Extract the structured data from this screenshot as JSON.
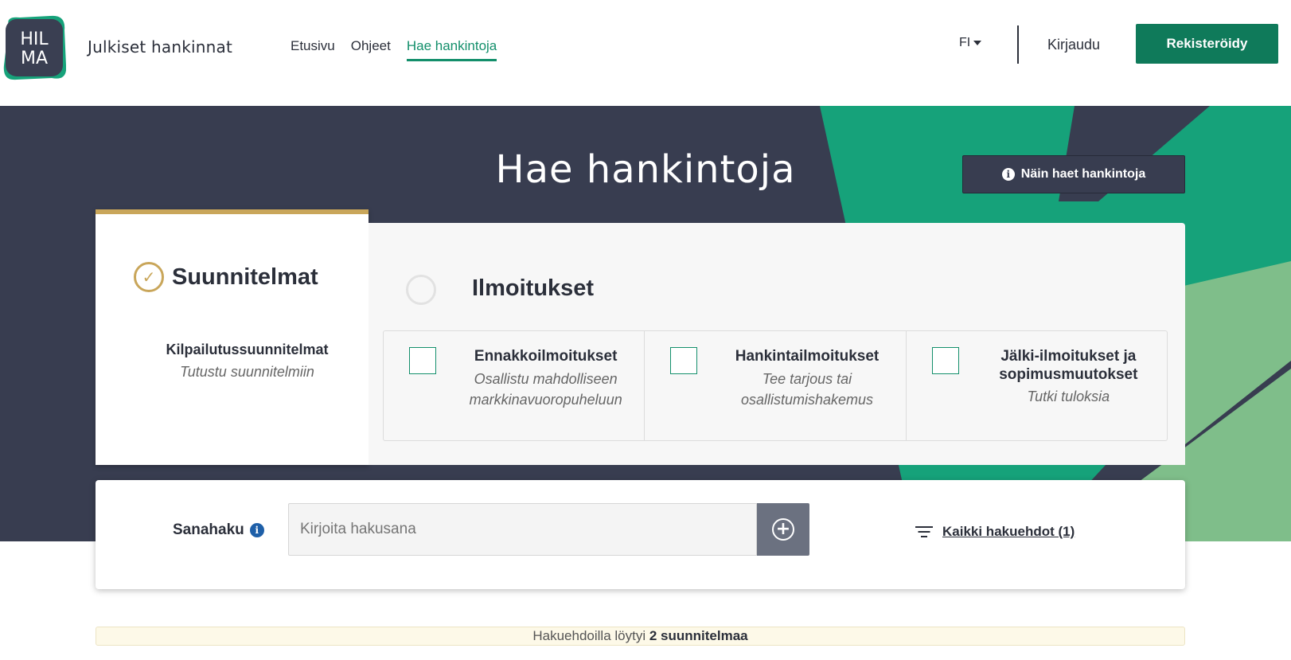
{
  "header": {
    "logo_text": "HIL MA",
    "brand": "Julkiset hankinnat",
    "nav": [
      {
        "label": "Etusivu",
        "active": false
      },
      {
        "label": "Ohjeet",
        "active": false
      },
      {
        "label": "Hae hankintoja",
        "active": true
      }
    ],
    "language": "FI",
    "login_label": "Kirjaudu",
    "register_label": "Rekisteröidy"
  },
  "hero": {
    "title": "Hae hankintoja",
    "help_button": "Näin haet hankintoja",
    "help_icon": "info-icon"
  },
  "tabs": {
    "plans": {
      "title": "Suunnitelmat",
      "selected": true,
      "subtitle": "Kilpailutussuunnitelmat",
      "description": "Tutustu suunnitelmiin"
    },
    "notices": {
      "title": "Ilmoitukset",
      "selected": false,
      "items": [
        {
          "title": "Ennakkoilmoitukset",
          "description_line1": "Osallistu mahdolliseen",
          "description_line2": "markkinavuoropuheluun",
          "checked": false
        },
        {
          "title": "Hankintailmoitukset",
          "description_line1": "Tee tarjous tai",
          "description_line2": "osallistumishakemus",
          "checked": false
        },
        {
          "title_line1": "Jälki-ilmoitukset ja",
          "title_line2": "sopimusmuutokset",
          "description": "Tutki tuloksia",
          "checked": false
        }
      ]
    }
  },
  "search": {
    "label": "Sanahaku",
    "placeholder": "Kirjoita hakusana",
    "value": "",
    "all_filters_label": "Kaikki hakuehdot (1)"
  },
  "results": {
    "prefix": "Hakuehdoilla löytyi",
    "count_text": "2 suunnitelmaa"
  },
  "colors": {
    "brand_green": "#0f7a5a",
    "accent_green": "#138f6b",
    "hero_bg": "#383d50",
    "plans_accent": "#c9a65a",
    "light_green": "#7fbe8a"
  }
}
